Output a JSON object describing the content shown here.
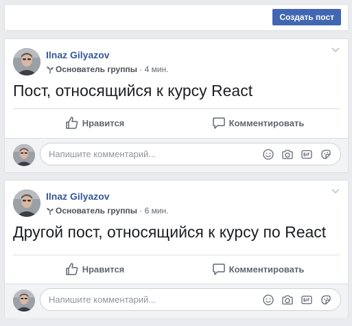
{
  "toolbar": {
    "create_post_label": "Создать пост"
  },
  "composer": {
    "placeholder": "Напишите комментарий..."
  },
  "posts": [
    {
      "author": "Ilnaz Gilyazov",
      "role": "Основатель группы",
      "separator": "·",
      "time": "4 мин.",
      "text": "Пост, относящийся к курсу React",
      "like_label": "Нравится",
      "comment_label": "Комментировать"
    },
    {
      "author": "Ilnaz Gilyazov",
      "role": "Основатель группы",
      "separator": "·",
      "time": "6 мин.",
      "text": "Другой пост, относящийся к курсу по React",
      "like_label": "Нравится",
      "comment_label": "Комментировать"
    }
  ],
  "colors": {
    "brand": "#4267b2",
    "author": "#365899",
    "page_bg": "#e9ebee"
  },
  "icons": [
    "sprout-icon",
    "chevron-down-icon",
    "like-icon",
    "comment-icon",
    "emoji-icon",
    "camera-icon",
    "gif-icon",
    "sticker-icon"
  ]
}
